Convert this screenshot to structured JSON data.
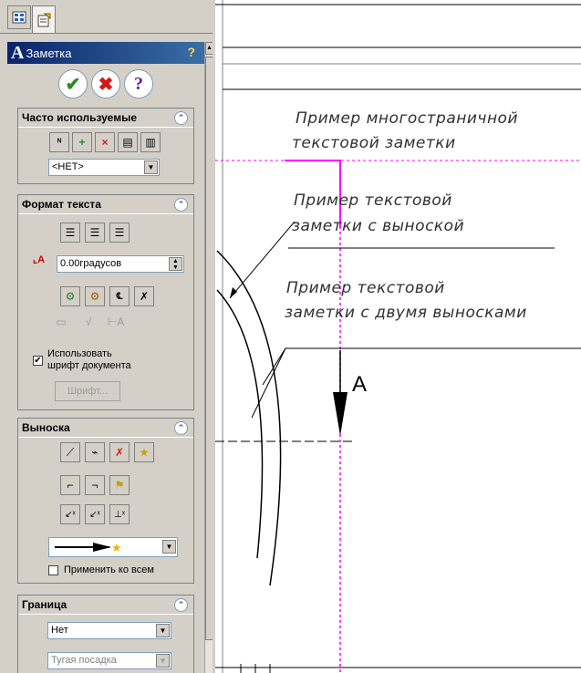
{
  "panel": {
    "tabs": [
      {
        "name": "feature-manager",
        "icon": "tree-icon"
      },
      {
        "name": "property-manager",
        "icon": "properties-icon"
      }
    ],
    "title": "Заметка",
    "actions": {
      "ok": "✔",
      "cancel": "✖",
      "help": "?"
    }
  },
  "groups": {
    "favorites": {
      "header": "Часто используемые",
      "combo_value": "<НЕТ>"
    },
    "text_format": {
      "header": "Формат текста",
      "angle_value": "0.00градусов",
      "use_doc_font_label": "Использовать\nшрифт документа",
      "use_doc_font_checked": true,
      "font_button": "Шрифт..."
    },
    "leader": {
      "header": "Выноска",
      "apply_all_label": "Применить ко всем",
      "apply_all_checked": false
    },
    "border": {
      "header": "Граница",
      "style_value": "Нет",
      "size_value": "Тугая посадка"
    }
  },
  "drawing": {
    "note1_line1": "Пример многостраничной",
    "note1_line2": "текстовой заметки",
    "note2_line1": "Пример  текстовой",
    "note2_line2": "заметки с выноской",
    "note3_line1": "Пример  текстовой",
    "note3_line2": "заметки с двумя выносками",
    "section_label": "A",
    "colors": {
      "magenta": "#ff00ff",
      "line": "#000000"
    }
  }
}
